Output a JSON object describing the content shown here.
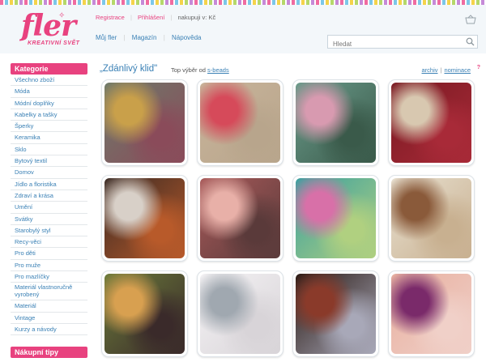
{
  "brand": {
    "logo": "fler",
    "tagline": "KREATIVNÍ SVĚT"
  },
  "top_links": {
    "register": "Registrace",
    "login": "Přihlášení",
    "currency": "nakupuji v: Kč"
  },
  "nav": {
    "items": [
      "Můj fler",
      "Magazín",
      "Nápověda"
    ]
  },
  "search": {
    "placeholder": "Hledat"
  },
  "sidebar": {
    "heading": "Kategorie",
    "items": [
      "Všechno zboží",
      "Móda",
      "Módní doplňky",
      "Kabelky a tašky",
      "Šperky",
      "Keramika",
      "Sklo",
      "Bytový textil",
      "Domov",
      "Jídlo a floristika",
      "Zdraví a krása",
      "Umění",
      "Svátky",
      "Starobylý styl",
      "Recy-věci",
      "Pro děti",
      "Pro muže",
      "Pro mazlíčky",
      "Materiál vlastnoručně vyrobený",
      "Materiál",
      "Vintage",
      "Kurzy a návody"
    ],
    "heading2": "Nákupní tipy"
  },
  "content": {
    "title": "„Zdánlivý klid\"",
    "subtitle_prefix": "Top výběr od ",
    "subtitle_user": "s-beads",
    "archive": "archiv",
    "nominate": "nominace",
    "info": "?"
  },
  "tiles": [
    {
      "name": "pendant-necklace",
      "colors": [
        "#6e7a6a",
        "#c9a04a",
        "#8a4b5a"
      ]
    },
    {
      "name": "embroidered-jellyfish",
      "colors": [
        "#c8b49a",
        "#d64a5a",
        "#b8a58c"
      ]
    },
    {
      "name": "dragonfly-textile",
      "colors": [
        "#6a9a8a",
        "#d89ab0",
        "#3a5a4a"
      ]
    },
    {
      "name": "lace-tablet-case",
      "colors": [
        "#7a1a22",
        "#d8c8b0",
        "#a82a38"
      ]
    },
    {
      "name": "beaded-earrings",
      "colors": [
        "#3a2a24",
        "#d8d0c8",
        "#b85a2a"
      ]
    },
    {
      "name": "bead-bracelets",
      "colors": [
        "#a85a5a",
        "#e8b0a8",
        "#5a3a3a"
      ]
    },
    {
      "name": "feather-painting",
      "colors": [
        "#3aa0a0",
        "#d870a8",
        "#b0d080"
      ]
    },
    {
      "name": "drawer-pouch",
      "colors": [
        "#e8e0d0",
        "#8a5a3a",
        "#c8b090"
      ]
    },
    {
      "name": "floral-dress-woman",
      "colors": [
        "#6a7a3a",
        "#d8a050",
        "#3a2a2a"
      ]
    },
    {
      "name": "white-shirts",
      "colors": [
        "#f4f2f4",
        "#a0a8b0",
        "#d8d4d8"
      ]
    },
    {
      "name": "glass-bead-necklace",
      "colors": [
        "#2a1a14",
        "#8a3a2a",
        "#a8a8b8"
      ]
    },
    {
      "name": "ring-on-hand",
      "colors": [
        "#e8b0a0",
        "#7a2a6a",
        "#f0d0c8"
      ]
    }
  ]
}
